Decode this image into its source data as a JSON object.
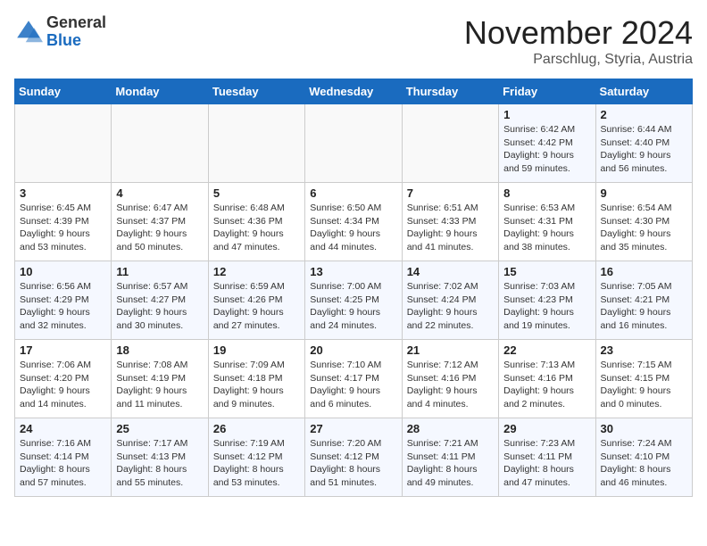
{
  "logo": {
    "general": "General",
    "blue": "Blue"
  },
  "title": {
    "month_year": "November 2024",
    "location": "Parschlug, Styria, Austria"
  },
  "headers": [
    "Sunday",
    "Monday",
    "Tuesday",
    "Wednesday",
    "Thursday",
    "Friday",
    "Saturday"
  ],
  "weeks": [
    [
      {
        "day": "",
        "info": ""
      },
      {
        "day": "",
        "info": ""
      },
      {
        "day": "",
        "info": ""
      },
      {
        "day": "",
        "info": ""
      },
      {
        "day": "",
        "info": ""
      },
      {
        "day": "1",
        "info": "Sunrise: 6:42 AM\nSunset: 4:42 PM\nDaylight: 9 hours and 59 minutes."
      },
      {
        "day": "2",
        "info": "Sunrise: 6:44 AM\nSunset: 4:40 PM\nDaylight: 9 hours and 56 minutes."
      }
    ],
    [
      {
        "day": "3",
        "info": "Sunrise: 6:45 AM\nSunset: 4:39 PM\nDaylight: 9 hours and 53 minutes."
      },
      {
        "day": "4",
        "info": "Sunrise: 6:47 AM\nSunset: 4:37 PM\nDaylight: 9 hours and 50 minutes."
      },
      {
        "day": "5",
        "info": "Sunrise: 6:48 AM\nSunset: 4:36 PM\nDaylight: 9 hours and 47 minutes."
      },
      {
        "day": "6",
        "info": "Sunrise: 6:50 AM\nSunset: 4:34 PM\nDaylight: 9 hours and 44 minutes."
      },
      {
        "day": "7",
        "info": "Sunrise: 6:51 AM\nSunset: 4:33 PM\nDaylight: 9 hours and 41 minutes."
      },
      {
        "day": "8",
        "info": "Sunrise: 6:53 AM\nSunset: 4:31 PM\nDaylight: 9 hours and 38 minutes."
      },
      {
        "day": "9",
        "info": "Sunrise: 6:54 AM\nSunset: 4:30 PM\nDaylight: 9 hours and 35 minutes."
      }
    ],
    [
      {
        "day": "10",
        "info": "Sunrise: 6:56 AM\nSunset: 4:29 PM\nDaylight: 9 hours and 32 minutes."
      },
      {
        "day": "11",
        "info": "Sunrise: 6:57 AM\nSunset: 4:27 PM\nDaylight: 9 hours and 30 minutes."
      },
      {
        "day": "12",
        "info": "Sunrise: 6:59 AM\nSunset: 4:26 PM\nDaylight: 9 hours and 27 minutes."
      },
      {
        "day": "13",
        "info": "Sunrise: 7:00 AM\nSunset: 4:25 PM\nDaylight: 9 hours and 24 minutes."
      },
      {
        "day": "14",
        "info": "Sunrise: 7:02 AM\nSunset: 4:24 PM\nDaylight: 9 hours and 22 minutes."
      },
      {
        "day": "15",
        "info": "Sunrise: 7:03 AM\nSunset: 4:23 PM\nDaylight: 9 hours and 19 minutes."
      },
      {
        "day": "16",
        "info": "Sunrise: 7:05 AM\nSunset: 4:21 PM\nDaylight: 9 hours and 16 minutes."
      }
    ],
    [
      {
        "day": "17",
        "info": "Sunrise: 7:06 AM\nSunset: 4:20 PM\nDaylight: 9 hours and 14 minutes."
      },
      {
        "day": "18",
        "info": "Sunrise: 7:08 AM\nSunset: 4:19 PM\nDaylight: 9 hours and 11 minutes."
      },
      {
        "day": "19",
        "info": "Sunrise: 7:09 AM\nSunset: 4:18 PM\nDaylight: 9 hours and 9 minutes."
      },
      {
        "day": "20",
        "info": "Sunrise: 7:10 AM\nSunset: 4:17 PM\nDaylight: 9 hours and 6 minutes."
      },
      {
        "day": "21",
        "info": "Sunrise: 7:12 AM\nSunset: 4:16 PM\nDaylight: 9 hours and 4 minutes."
      },
      {
        "day": "22",
        "info": "Sunrise: 7:13 AM\nSunset: 4:16 PM\nDaylight: 9 hours and 2 minutes."
      },
      {
        "day": "23",
        "info": "Sunrise: 7:15 AM\nSunset: 4:15 PM\nDaylight: 9 hours and 0 minutes."
      }
    ],
    [
      {
        "day": "24",
        "info": "Sunrise: 7:16 AM\nSunset: 4:14 PM\nDaylight: 8 hours and 57 minutes."
      },
      {
        "day": "25",
        "info": "Sunrise: 7:17 AM\nSunset: 4:13 PM\nDaylight: 8 hours and 55 minutes."
      },
      {
        "day": "26",
        "info": "Sunrise: 7:19 AM\nSunset: 4:12 PM\nDaylight: 8 hours and 53 minutes."
      },
      {
        "day": "27",
        "info": "Sunrise: 7:20 AM\nSunset: 4:12 PM\nDaylight: 8 hours and 51 minutes."
      },
      {
        "day": "28",
        "info": "Sunrise: 7:21 AM\nSunset: 4:11 PM\nDaylight: 8 hours and 49 minutes."
      },
      {
        "day": "29",
        "info": "Sunrise: 7:23 AM\nSunset: 4:11 PM\nDaylight: 8 hours and 47 minutes."
      },
      {
        "day": "30",
        "info": "Sunrise: 7:24 AM\nSunset: 4:10 PM\nDaylight: 8 hours and 46 minutes."
      }
    ]
  ]
}
